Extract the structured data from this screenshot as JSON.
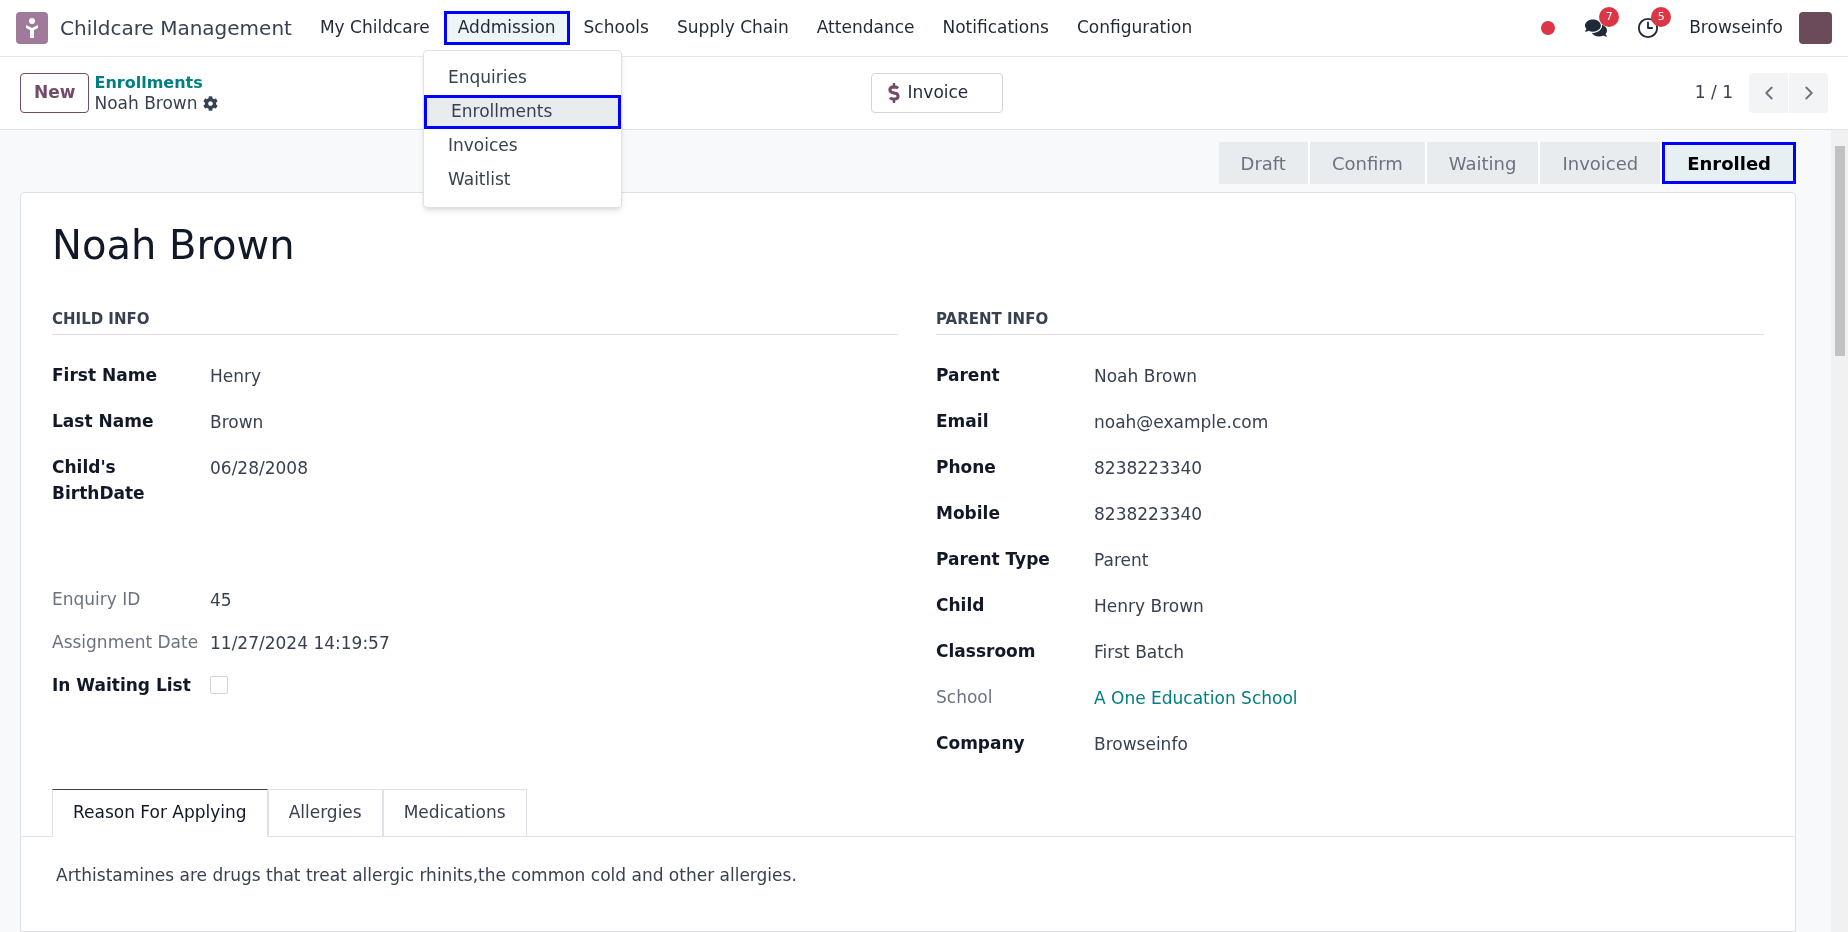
{
  "app": {
    "title": "Childcare Management"
  },
  "menu": [
    {
      "label": "My Childcare",
      "selected": false
    },
    {
      "label": "Addmission",
      "selected": true
    },
    {
      "label": "Schools",
      "selected": false
    },
    {
      "label": "Supply Chain",
      "selected": false
    },
    {
      "label": "Attendance",
      "selected": false
    },
    {
      "label": "Notifications",
      "selected": false
    },
    {
      "label": "Configuration",
      "selected": false
    }
  ],
  "dropdown": [
    {
      "label": "Enquiries",
      "selected": false
    },
    {
      "label": "Enrollments",
      "selected": true
    },
    {
      "label": "Invoices",
      "selected": false
    },
    {
      "label": "Waitlist",
      "selected": false
    }
  ],
  "systray": {
    "messages_count": "7",
    "activities_count": "5",
    "user": "Browseinfo"
  },
  "control": {
    "new_button": "New",
    "breadcrumb": "Enrollments",
    "record": "Noah Brown",
    "invoice_button": "Invoice",
    "pager": "1 / 1"
  },
  "stages": [
    {
      "label": "Draft",
      "selected": false
    },
    {
      "label": "Confirm",
      "selected": false
    },
    {
      "label": "Waiting",
      "selected": false
    },
    {
      "label": "Invoiced",
      "selected": false
    },
    {
      "label": "Enrolled",
      "selected": true
    }
  ],
  "record_title": "Noah Brown",
  "child_info": {
    "heading": "CHILD INFO",
    "fields": [
      {
        "label": "First Name",
        "value": "Henry",
        "muted": false,
        "kind": "text"
      },
      {
        "label": "Last Name",
        "value": "Brown",
        "muted": false,
        "kind": "text"
      },
      {
        "label": "Child's BirthDate",
        "value": "06/28/2008",
        "muted": false,
        "kind": "text"
      }
    ],
    "extra_fields": [
      {
        "label": "Enquiry ID",
        "value": "45",
        "muted": true,
        "kind": "text"
      },
      {
        "label": "Assignment Date",
        "value": "11/27/2024 14:19:57",
        "muted": true,
        "kind": "text"
      },
      {
        "label": "In Waiting List",
        "checked": false,
        "muted": false,
        "kind": "checkbox"
      }
    ]
  },
  "parent_info": {
    "heading": "PARENT INFO",
    "fields": [
      {
        "label": "Parent",
        "value": "Noah Brown",
        "muted": false,
        "kind": "text"
      },
      {
        "label": "Email",
        "value": "noah@example.com",
        "muted": false,
        "kind": "text"
      },
      {
        "label": "Phone",
        "value": "8238223340",
        "muted": false,
        "kind": "text"
      },
      {
        "label": "Mobile",
        "value": "8238223340",
        "muted": false,
        "kind": "text"
      },
      {
        "label": "Parent Type",
        "value": "Parent",
        "muted": false,
        "kind": "text"
      },
      {
        "label": "Child",
        "value": "Henry Brown",
        "muted": false,
        "kind": "text"
      },
      {
        "label": "Classroom",
        "value": "First Batch",
        "muted": false,
        "kind": "text"
      },
      {
        "label": "School",
        "value": "A One Education School",
        "muted": true,
        "kind": "link"
      },
      {
        "label": "Company",
        "value": "Browseinfo",
        "muted": false,
        "kind": "text"
      }
    ]
  },
  "tabs": [
    {
      "label": "Reason For Applying",
      "selected": true
    },
    {
      "label": "Allergies",
      "selected": false
    },
    {
      "label": "Medications",
      "selected": false
    }
  ],
  "tab_content": "Arthistamines are drugs that treat allergic rhinits,the common cold and other allergies."
}
